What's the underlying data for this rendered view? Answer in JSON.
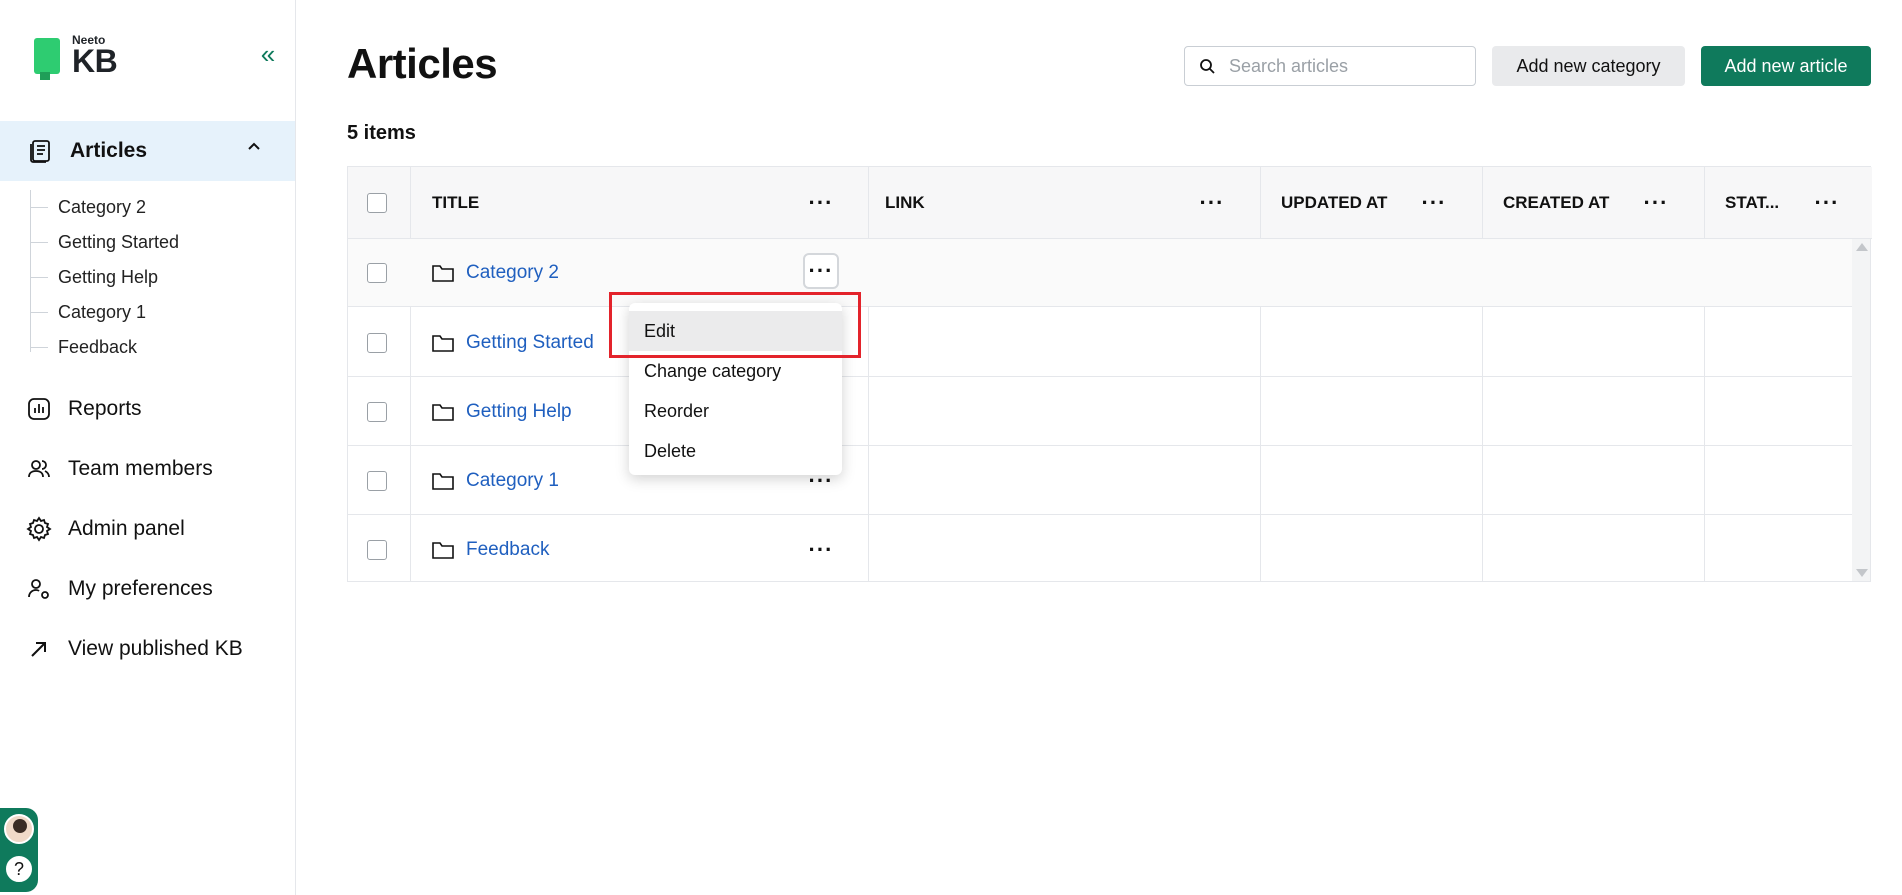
{
  "sidebar": {
    "logo": {
      "small": "Neeto",
      "big": "KB"
    },
    "articles_label": "Articles",
    "categories": [
      "Category 2",
      "Getting Started",
      "Getting Help",
      "Category 1",
      "Feedback"
    ],
    "nav": [
      {
        "label": "Reports",
        "icon": "reports-icon"
      },
      {
        "label": "Team members",
        "icon": "team-icon"
      },
      {
        "label": "Admin panel",
        "icon": "gear-icon"
      },
      {
        "label": "My preferences",
        "icon": "user-settings-icon"
      },
      {
        "label": "View published KB",
        "icon": "external-arrow-icon"
      }
    ],
    "help_label": "?"
  },
  "header": {
    "title": "Articles",
    "search_placeholder": "Search articles",
    "add_category_label": "Add new category",
    "add_article_label": "Add new article"
  },
  "count_label": "5 items",
  "table": {
    "columns": [
      "TITLE",
      "LINK",
      "UPDATED AT",
      "CREATED AT",
      "STAT..."
    ],
    "rows": [
      "Category 2",
      "Getting Started",
      "Getting Help",
      "Category 1",
      "Feedback"
    ]
  },
  "menu": {
    "items": [
      "Edit",
      "Change category",
      "Reorder",
      "Delete"
    ]
  },
  "colors": {
    "brand": "#0f7a5c",
    "link": "#1f5fbf",
    "highlight": "#e3232b",
    "active_nav_bg": "#e6f2fb"
  }
}
